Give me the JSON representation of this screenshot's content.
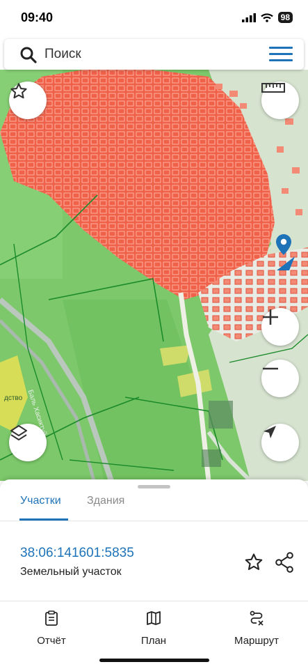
{
  "status": {
    "time": "09:40",
    "battery": "98"
  },
  "search": {
    "placeholder": "Поиск"
  },
  "map": {
    "place_label_1": "Баль Хасиктуй",
    "place_label_2": "дство",
    "icons": [
      "star-icon",
      "ruler-icon",
      "plus-icon",
      "minus-icon",
      "layers-icon",
      "locate-icon",
      "map-pin-icon"
    ]
  },
  "sheet": {
    "tabs": [
      {
        "label": "Участки",
        "active": true
      },
      {
        "label": "Здания",
        "active": false
      }
    ],
    "parcel": {
      "cadastral_number": "38:06:141601:5835",
      "type": "Земельный участок"
    }
  },
  "bottom_nav": [
    {
      "label": "Отчёт",
      "icon": "report-icon"
    },
    {
      "label": "План",
      "icon": "map-icon"
    },
    {
      "label": "Маршрут",
      "icon": "route-icon"
    }
  ],
  "colors": {
    "accent": "#1e73b8",
    "parcels": "#f0614a",
    "forest": "#7cc86a"
  }
}
